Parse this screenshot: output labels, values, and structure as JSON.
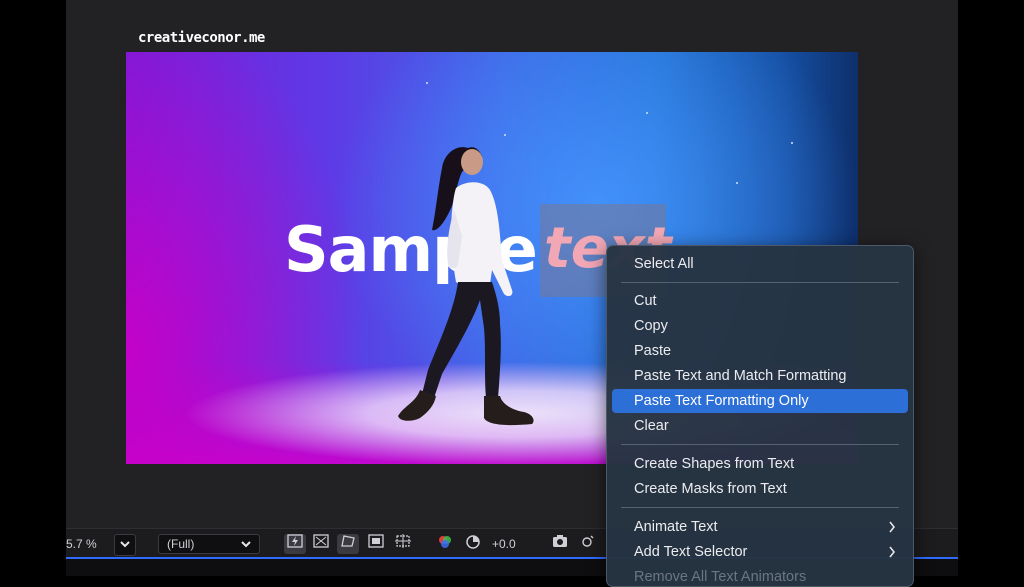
{
  "watermark": "creativeconor.me",
  "composition": {
    "main_text": "Sample",
    "selected_text": "text"
  },
  "toolbar": {
    "zoom_value": "5.7",
    "zoom_unit": "%",
    "zoom_dropdown_icon": "chevron-down",
    "resolution": "(Full)",
    "resolution_icon": "chevron-down",
    "exposure": "+0.0",
    "icons": [
      "fast-preview",
      "transparency-grid",
      "mask-path-visibility",
      "region-of-interest",
      "toggle-guides",
      "color-channels",
      "reset-exposure",
      "snapshot",
      "show-snapshot"
    ]
  },
  "context_menu": {
    "items": [
      {
        "label": "Select All"
      },
      {
        "label": "Cut"
      },
      {
        "label": "Copy"
      },
      {
        "label": "Paste"
      },
      {
        "label": "Paste Text and Match Formatting"
      },
      {
        "label": "Paste Text Formatting Only",
        "highlighted": true
      },
      {
        "label": "Clear"
      },
      {
        "label": "Create Shapes from Text"
      },
      {
        "label": "Create Masks from Text"
      },
      {
        "label": "Animate Text",
        "submenu": true
      },
      {
        "label": "Add Text Selector",
        "submenu": true
      },
      {
        "label": "Remove All Text Animators"
      }
    ]
  },
  "colors": {
    "accent": "#2c6fd6",
    "exposure_blue": "#3f7dff",
    "selected_text": "#f2a7b4"
  }
}
